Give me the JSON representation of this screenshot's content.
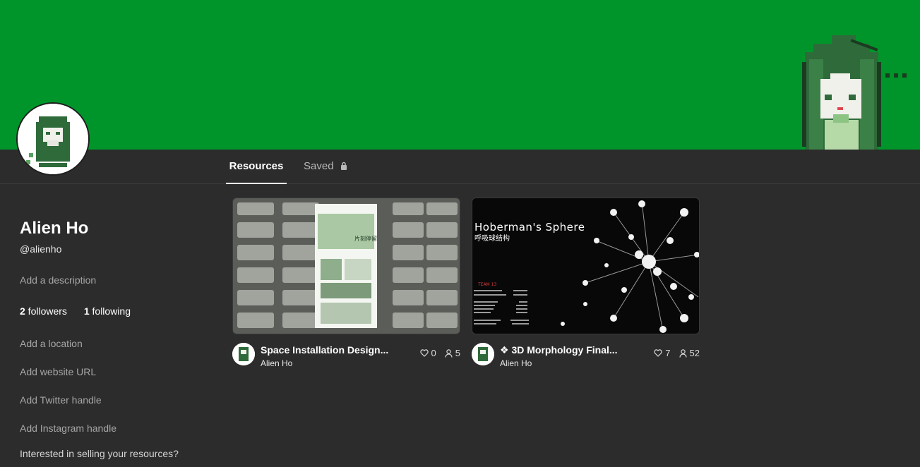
{
  "colors": {
    "banner": "#00952a",
    "background": "#2c2c2c",
    "muted_text": "#a6a6a6"
  },
  "tabs": [
    {
      "label": "Resources",
      "active": true
    },
    {
      "label": "Saved",
      "icon": "lock-icon",
      "active": false
    }
  ],
  "profile": {
    "name": "Alien Ho",
    "handle": "@alienho",
    "add_description": "Add a description",
    "followers_count": "2",
    "followers_label": " followers",
    "following_count": "1",
    "following_label": " following",
    "add_location": "Add a location",
    "add_website": "Add website URL",
    "add_twitter": "Add Twitter handle",
    "add_instagram": "Add Instagram handle",
    "sell_prompt": "Interested in selling your resources?"
  },
  "resources": [
    {
      "title": "Space Installation Design...",
      "author": "Alien Ho",
      "likes": "0",
      "users": "5",
      "thumb_text": "片刻停留"
    },
    {
      "title": "❖ 3D Morphology Final...",
      "author": "Alien Ho",
      "likes": "7",
      "users": "52",
      "thumb_title": "Hoberman's Sphere",
      "thumb_subtitle": "呼吸球结构",
      "thumb_team": "TEAM 13"
    }
  ]
}
